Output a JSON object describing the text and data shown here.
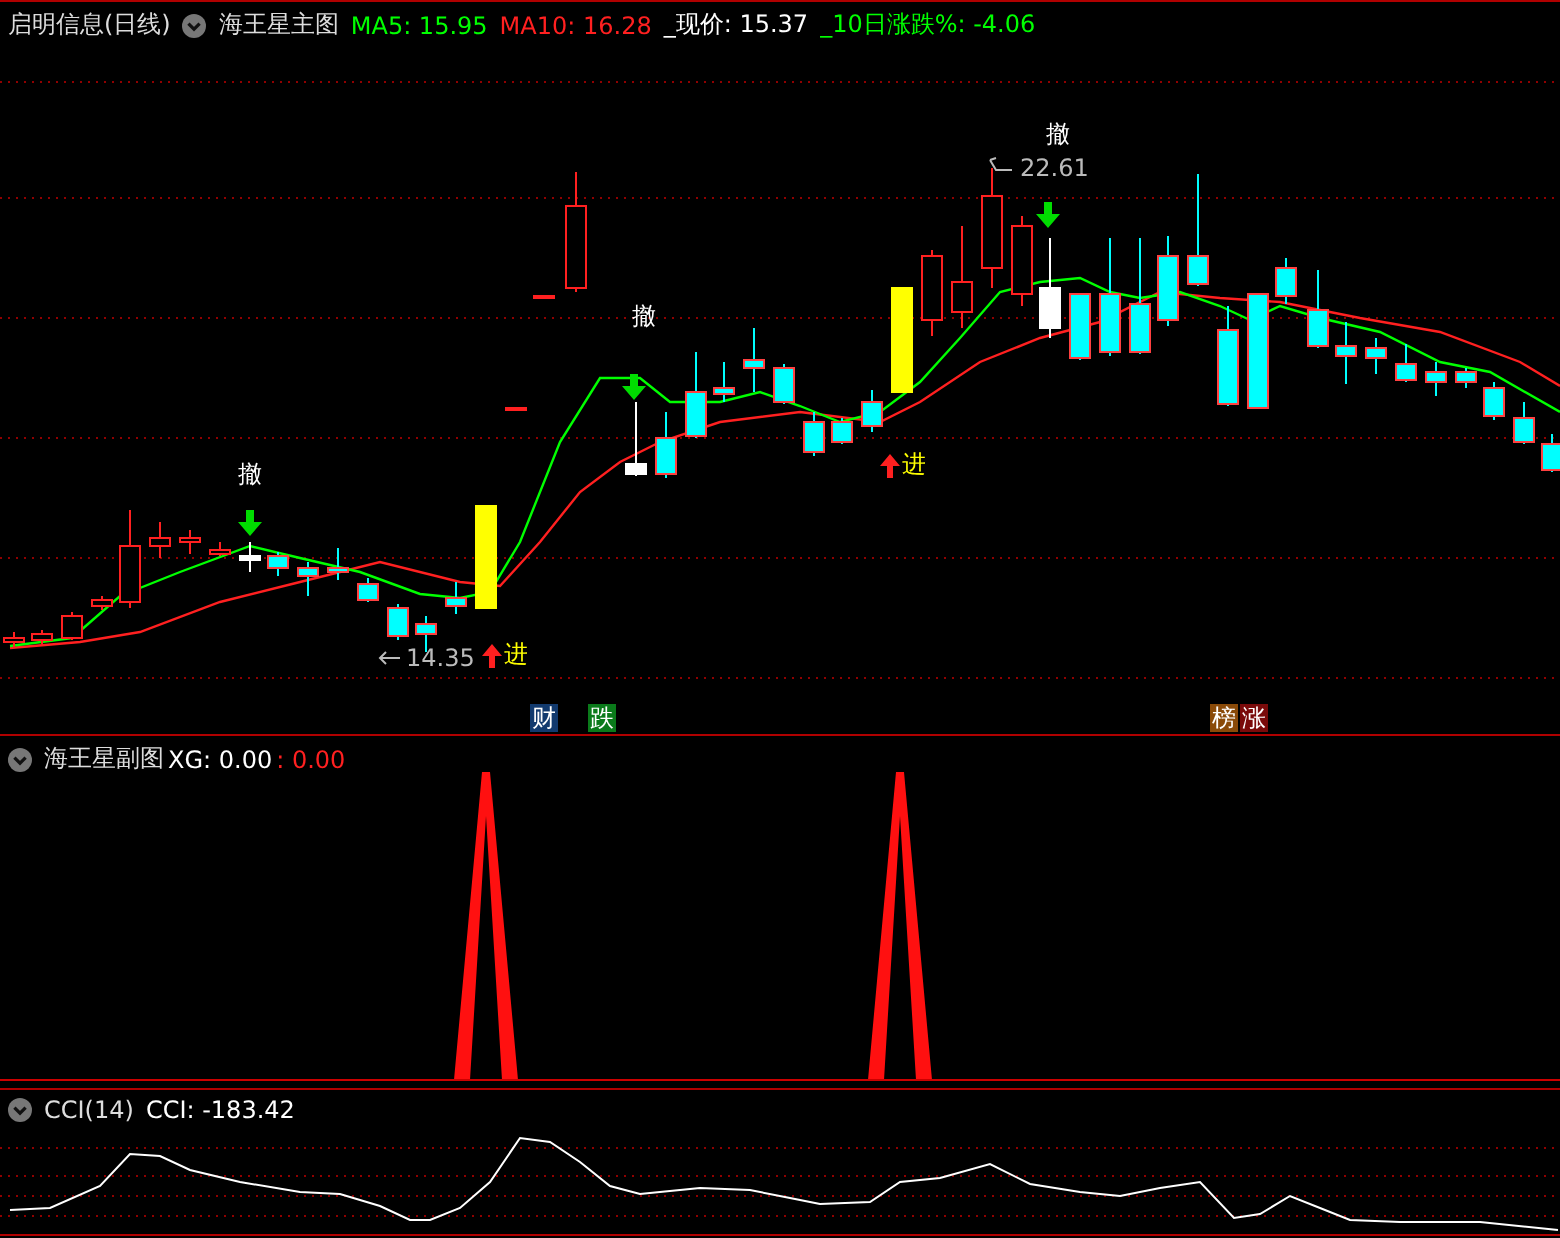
{
  "main_panel": {
    "stock_title": "启明信息(日线)",
    "indicator_name": "海王星主图",
    "readings": [
      {
        "text": "MA5: 15.95",
        "color": "#00ff00"
      },
      {
        "text": "MA10: 16.28",
        "color": "#ff2020"
      },
      {
        "text": "_现价: 15.37",
        "color": "#ffffff"
      },
      {
        "text": "_10日涨跌%: -4.06",
        "color": "#00ff00"
      }
    ],
    "markers": [
      {
        "kind": "sell",
        "text": "撤"
      },
      {
        "kind": "sell",
        "text": "撤"
      },
      {
        "kind": "sell",
        "text": "撤"
      },
      {
        "kind": "buy",
        "text": "进"
      },
      {
        "kind": "buy",
        "text": "进"
      }
    ],
    "price_labels": [
      {
        "kind": "high",
        "text": "22.61"
      },
      {
        "kind": "low",
        "text": "14.35"
      }
    ],
    "badges": [
      {
        "text": "财",
        "color": "#123a6e"
      },
      {
        "text": "跌",
        "color": "#0a7a1a"
      },
      {
        "text": "榜",
        "color": "#8a4a08"
      },
      {
        "text": "涨",
        "color": "#7a0a0a"
      }
    ]
  },
  "sub_panel": {
    "indicator_name": "海王星副图",
    "readings": [
      {
        "text": "XG: 0.00",
        "color": "#ffffff"
      },
      {
        "text": ": 0.00",
        "color": "#ff2020"
      }
    ]
  },
  "cci_panel": {
    "indicator_name": "CCI(14)",
    "readings": [
      {
        "text": "CCI: -183.42",
        "color": "#ffffff"
      }
    ]
  }
}
